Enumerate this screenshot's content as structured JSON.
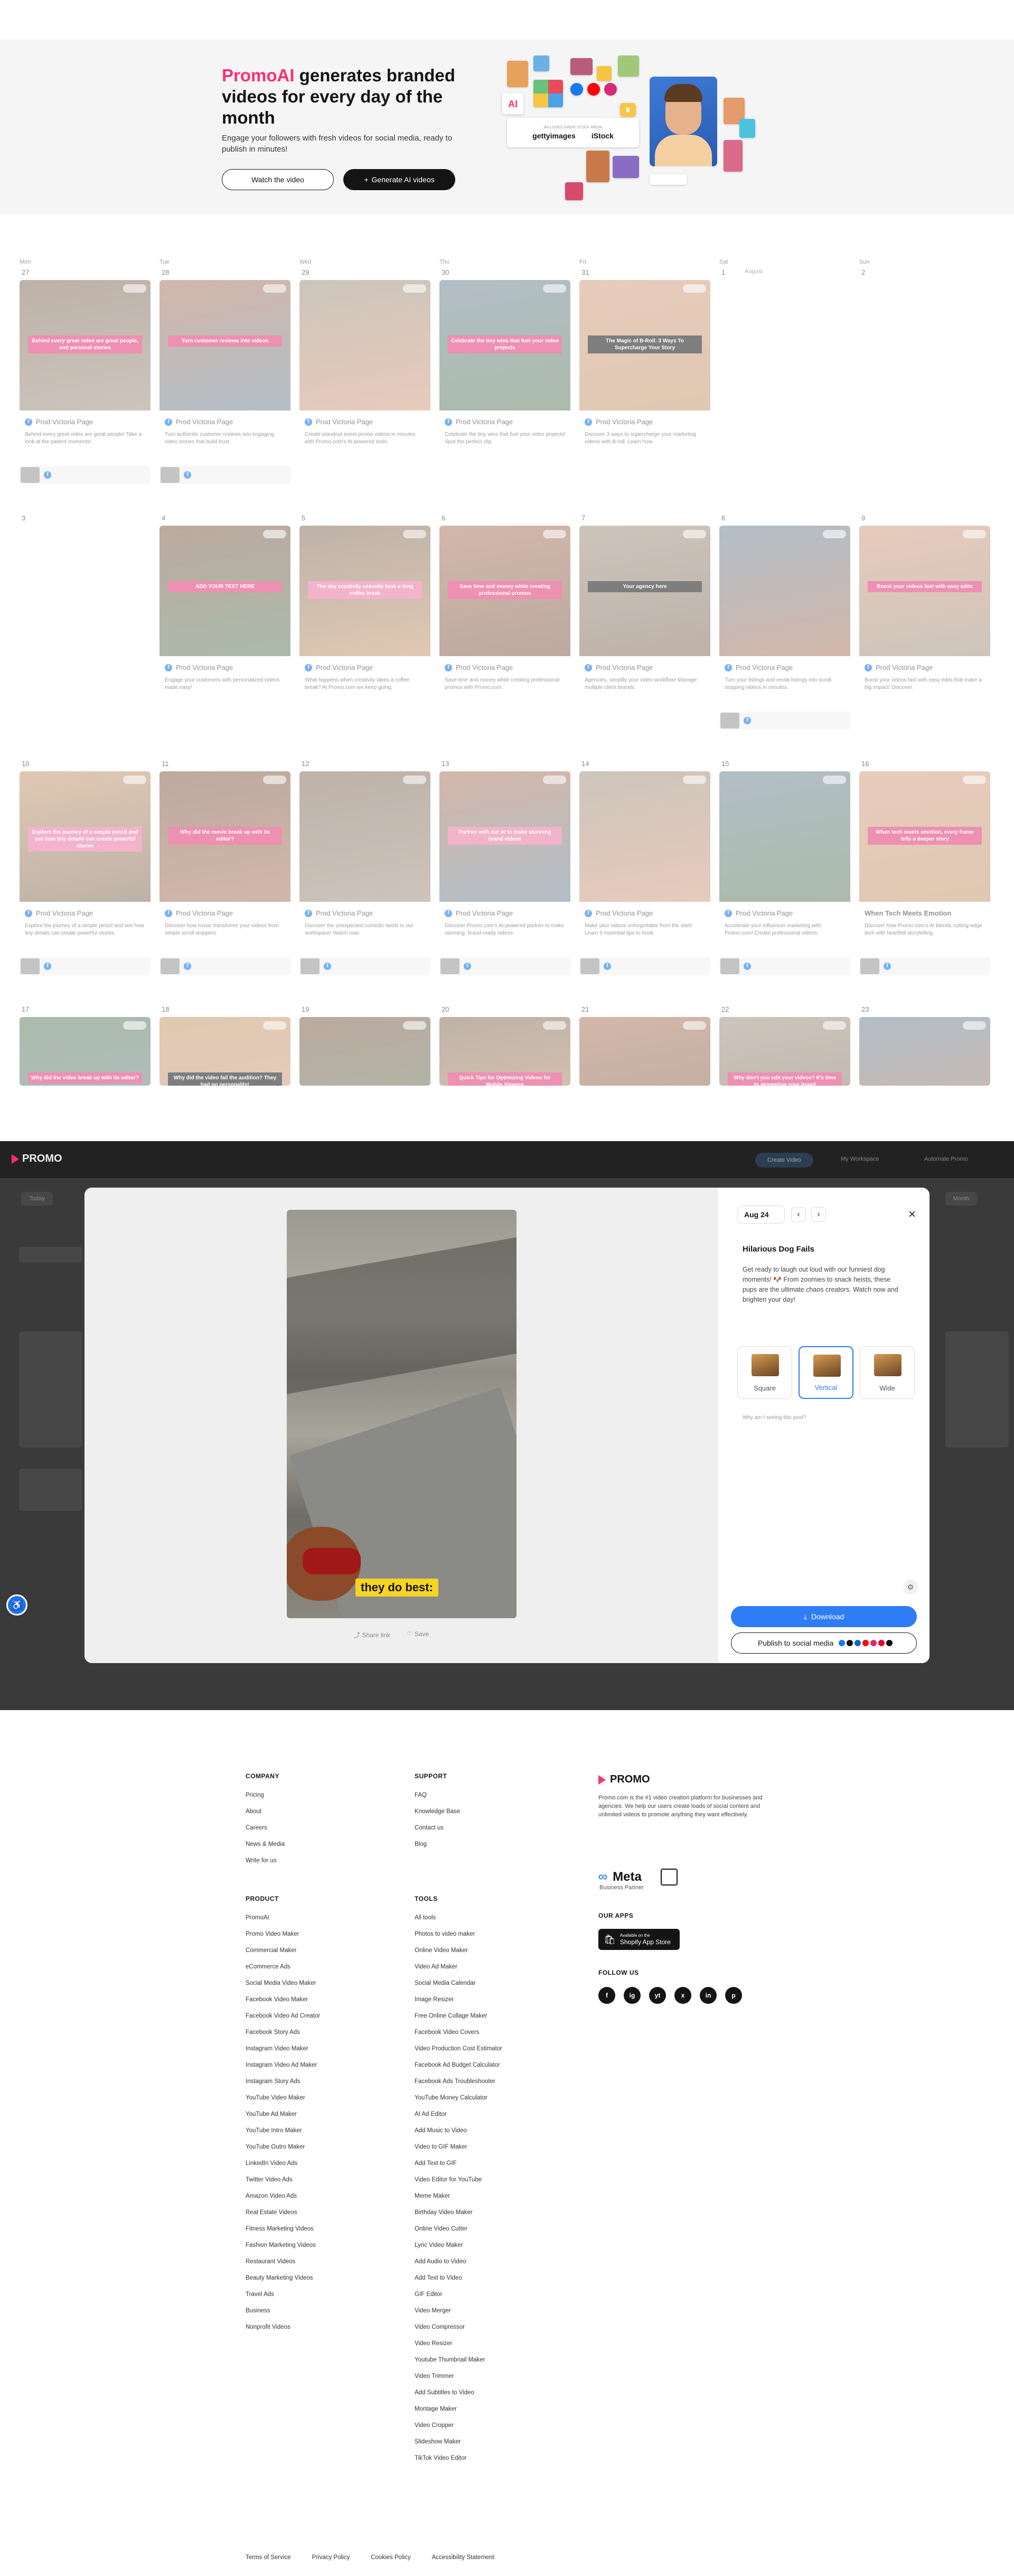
{
  "hero": {
    "title_brand": "PromoAI",
    "title_rest": " generates branded videos for every day of the month",
    "subtitle": "Engage your followers with fresh videos for social media, ready to publish in minutes!",
    "watch_label": "Watch the video",
    "generate_label": "Generate AI videos",
    "collage": {
      "ai_label": "AI",
      "stock_caption": "INCLUDES GREAT STOCK MEDIA",
      "getty_label": "gettyimages",
      "istock_label": "iStock"
    }
  },
  "calendar": {
    "days": [
      "Mon",
      "Tue",
      "Wed",
      "Thu",
      "Fri",
      "Sat",
      "Sun"
    ],
    "page_name": "Prod Victoria Page",
    "weeks": [
      {
        "dates": [
          "27",
          "28",
          "29",
          "30",
          "31",
          "1",
          "2"
        ]
      },
      {
        "dates": [
          "3",
          "4",
          "5",
          "6",
          "7",
          "8",
          "9"
        ]
      },
      {
        "dates": [
          "10",
          "11",
          "12",
          "13",
          "14",
          "15",
          "16"
        ]
      },
      {
        "dates": [
          "17",
          "18",
          "19",
          "20",
          "21",
          "22",
          "23"
        ]
      }
    ],
    "month_label": "August",
    "week1": [
      {
        "caption": "Behind every great video are great people, and personal stories",
        "desc": "Behind every great video are great people! Take a look at the patient moments!"
      },
      {
        "caption": "Turn customer reviews into videos",
        "desc": "Turn authentic customer reviews into engaging video stories that build trust."
      },
      {
        "caption": "",
        "desc": "Create standout event promo videos in minutes with Promo.com's AI-powered tools."
      },
      {
        "caption": "Celebrate the tiny wins that fuel your video projects",
        "desc": "Celebrate the tiny wins that fuel your video projects! Spot the perfect clip."
      },
      {
        "caption": "The Magic of B-Roll: 3 Ways To Supercharge Your Story",
        "desc": "Discover 3 ways to supercharge your marketing videos with B-roll. Learn how."
      }
    ],
    "week2": [
      {
        "caption": "ADD YOUR TEXT HERE",
        "desc": "Engage your customers with personalized videos made easy!"
      },
      {
        "caption": "The day creativity casually took a long coffee break",
        "desc": "What happens when creativity takes a coffee break? At Promo.com we keep going."
      },
      {
        "caption": "Save time and money while creating professional promos",
        "desc": "Save time and money while creating professional promos with Promo.com."
      },
      {
        "caption": "Your agency here",
        "desc": "Agencies, simplify your video workflow! Manage multiple client brands."
      },
      {
        "caption": "",
        "desc": "Turn your listings and rental listings into scroll-stopping videos in minutes."
      },
      {
        "caption": "Boost your videos fast with easy edits",
        "desc": "Boost your videos fast with easy edits that make a big impact! Discover."
      }
    ],
    "week3": [
      {
        "caption": "Explore the journey of a simple pencil and see how tiny details can create powerful stories",
        "desc": "Explore the journey of a simple pencil and see how tiny details can create powerful stories."
      },
      {
        "caption": "Why did the movie break up with its editor?",
        "desc": "Discover how music transforms your videos from simple scroll-stoppers."
      },
      {
        "caption": "",
        "desc": "Discover the unexpected comedic twists in our workspace! Watch now."
      },
      {
        "caption": "Partner with our AI to make stunning brand videos",
        "desc": "Discover Promo.com's AI-powered partner to make stunning, brand-ready videos."
      },
      {
        "caption": "",
        "desc": "Make your videos unforgettable from the start! Learn 5 essential tips to hook."
      },
      {
        "caption": "",
        "desc": "Accelerate your influencer marketing with Promo.com! Create professional videos."
      },
      {
        "caption": "When tech meets emotion, every frame tells a deeper story",
        "title": "When Tech Meets Emotion",
        "desc": "Discover how Promo.com's AI blends cutting-edge tech with heartfelt storytelling."
      }
    ],
    "week4": [
      {
        "caption": "Why did the video break up with its editor?"
      },
      {
        "caption": "Why did the video fail the audition? They had no personality!"
      },
      {
        "caption": ""
      },
      {
        "caption": "Quick Tips for Optimizing Videos for Mobile Viewing"
      },
      {
        "caption": ""
      },
      {
        "caption": "Why don't you edit your videos? It's time to streamline your brand"
      },
      {
        "caption": ""
      }
    ]
  },
  "app_bar": {
    "logo": "PROMO",
    "create_btn": "Create Video",
    "workspace": "My Workspace",
    "automate": "Automate Promo",
    "today": "Today",
    "month": "Month"
  },
  "modal": {
    "date": "Aug 24",
    "prev": "‹",
    "next": "›",
    "close": "×",
    "title": "Hilarious Dog Fails",
    "description": "Get ready to laugh out loud with our funniest dog moments! 🐶 From zoomies to snack heists, these pups are the ultimate chaos creators. Watch now and brighten your day!",
    "formats": [
      {
        "label": "Square"
      },
      {
        "label": "Vertical"
      },
      {
        "label": "Wide"
      }
    ],
    "hint": "Why am I seeing this post?",
    "video_caption": "they do best:",
    "share_label": "Share link",
    "save_label": "Save",
    "download_label": "Download",
    "publish_label": "Publish to social media"
  },
  "footer": {
    "company": {
      "heading": "COMPANY",
      "links": [
        "Pricing",
        "About",
        "Careers",
        "News & Media",
        "Write for us"
      ]
    },
    "support": {
      "heading": "SUPPORT",
      "links": [
        "FAQ",
        "Knowledge Base",
        "Contact us",
        "Blog"
      ]
    },
    "product": {
      "heading": "PRODUCT",
      "links": [
        "PromoAI",
        "Promo Video Maker",
        "Commercial Maker",
        "eCommerce Ads",
        "Social Media Video Maker",
        "Facebook Video Maker",
        "Facebook Video Ad Creator",
        "Facebook Story Ads",
        "Instagram Video Maker",
        "Instagram Video Ad Maker",
        "Instagram Story Ads",
        "YouTube Video Maker",
        "YouTube Ad Maker",
        "YouTube Intro Maker",
        "YouTube Outro Maker",
        "LinkedIn Video Ads",
        "Twitter Video Ads",
        "Amazon Video Ads",
        "Real Estate Videos",
        "Fitness Marketing Videos",
        "Fashion Marketing Videos",
        "Restaurant Videos",
        "Beauty Marketing Videos",
        "Travel Ads",
        "Business",
        "Nonprofit Videos"
      ]
    },
    "tools": {
      "heading": "TOOLS",
      "links": [
        "All tools",
        "Photos to video maker",
        "Online Video Maker",
        "Video Ad Maker",
        "Social Media Calendar",
        "Image Resizer",
        "Free Online Collage Maker",
        "Facebook Video Covers",
        "Video Production Cost Estimator",
        "Facebook Ad Budget Calculator",
        "Facebook Ads Troubleshooter",
        "YouTube Money Calculator",
        "AI Ad Editor",
        "Add Music to Video",
        "Video to GIF Maker",
        "Add Text to GIF",
        "Video Editor for YouTube",
        "Meme Maker",
        "Birthday Video Maker",
        "Online Video Cutter",
        "Lyric Video Maker",
        "Add Audio to Video",
        "Add Text to Video",
        "GIF Editor",
        "Video Merger",
        "Video Compressor",
        "Video Resizer",
        "Youtube Thumbnail Maker",
        "Video Trimmer",
        "Add Subtitles to Video",
        "Montage Maker",
        "Video Cropper",
        "Slideshow Maker",
        "TikTok Video Editor"
      ]
    },
    "brand": {
      "logo": "PROMO",
      "about": "Promo.com is the #1 video creation platform for businesses and agencies. We help our users create loads of social content and unlimited videos to promote anything they want effectively.",
      "meta": "Meta",
      "meta_partner": "Business Partner",
      "apps_heading": "OUR APPS",
      "store_small": "Available on the",
      "store_label": "Shopify App Store",
      "follow_heading": "FOLLOW US",
      "socials": [
        "f",
        "ig",
        "yt",
        "x",
        "in",
        "p"
      ]
    },
    "legal": [
      "Terms of Service",
      "Privacy Policy",
      "Cookies Policy",
      "Accessibility Statement"
    ]
  }
}
